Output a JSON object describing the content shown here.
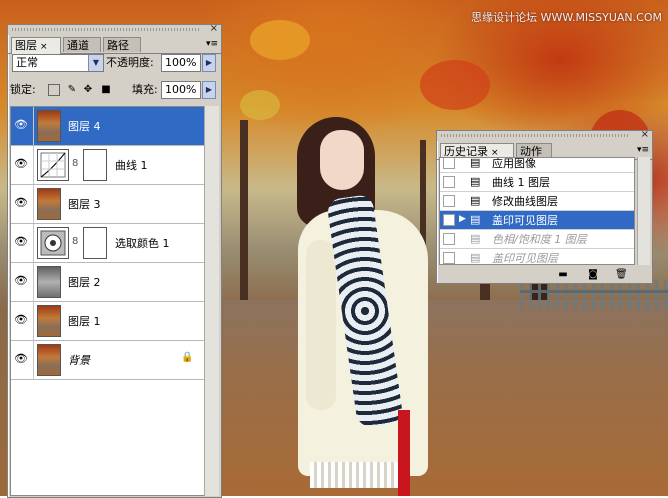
{
  "watermark": "思缘设计论坛 WWW.MISSYUAN.COM",
  "layers_panel": {
    "tabs": [
      {
        "label": "图层",
        "close": "×"
      },
      {
        "label": "通道"
      },
      {
        "label": "路径"
      }
    ],
    "menu_icon": "▾≡",
    "close_icon": "×",
    "blend_mode": "正常",
    "opacity_label": "不透明度:",
    "opacity_value": "100%",
    "lock_label": "锁定:",
    "fill_label": "填充:",
    "fill_value": "100%",
    "layers": [
      {
        "name": "图层 4",
        "selected": true
      },
      {
        "name": "曲线 1",
        "type": "curves"
      },
      {
        "name": "图层 3"
      },
      {
        "name": "选取颜色 1",
        "type": "selective-color"
      },
      {
        "name": "图层 2"
      },
      {
        "name": "图层 1"
      },
      {
        "name": "背景",
        "locked": true
      }
    ]
  },
  "history_panel": {
    "tabs": [
      {
        "label": "历史记录",
        "close": "×"
      },
      {
        "label": "动作"
      }
    ],
    "menu_icon": "▾≡",
    "close_icon": "×",
    "items": [
      {
        "label": "应用图像"
      },
      {
        "label": "曲线 1 图层"
      },
      {
        "label": "修改曲线图层"
      },
      {
        "label": "盖印可见图层",
        "selected": true
      },
      {
        "label": "色相/饱和度 1 图层",
        "dimmed": true
      },
      {
        "label": "盖印可见图层",
        "dimmed": true
      }
    ]
  },
  "colors": {
    "selection": "#316ac5",
    "panel_bg": "#d4d0c8"
  }
}
